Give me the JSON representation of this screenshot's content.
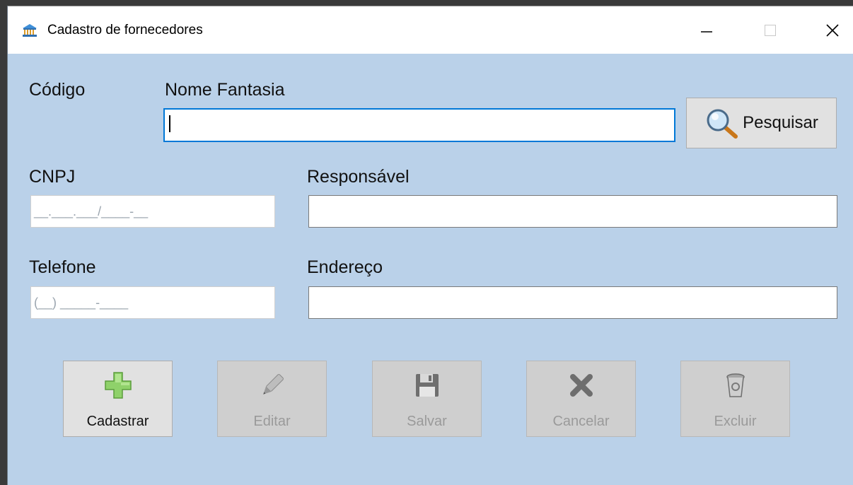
{
  "window": {
    "title": "Cadastro de fornecedores",
    "background_color": "#bad1e9"
  },
  "form": {
    "codigo_label": "Código",
    "nome_fantasia_label": "Nome Fantasia",
    "nome_fantasia_value": "",
    "search_button_label": "Pesquisar",
    "cnpj_label": "CNPJ",
    "cnpj_mask": "__.___.___/____-__",
    "responsavel_label": "Responsável",
    "responsavel_value": "",
    "telefone_label": "Telefone",
    "telefone_mask": "(__) _____-____",
    "endereco_label": "Endereço",
    "endereco_value": ""
  },
  "actions": [
    {
      "label": "Cadastrar",
      "icon": "plus-icon",
      "enabled": true
    },
    {
      "label": "Editar",
      "icon": "pencil-icon",
      "enabled": false
    },
    {
      "label": "Salvar",
      "icon": "floppy-disk-icon",
      "enabled": false
    },
    {
      "label": "Cancelar",
      "icon": "x-icon",
      "enabled": false
    },
    {
      "label": "Excluir",
      "icon": "trash-icon",
      "enabled": false
    }
  ]
}
